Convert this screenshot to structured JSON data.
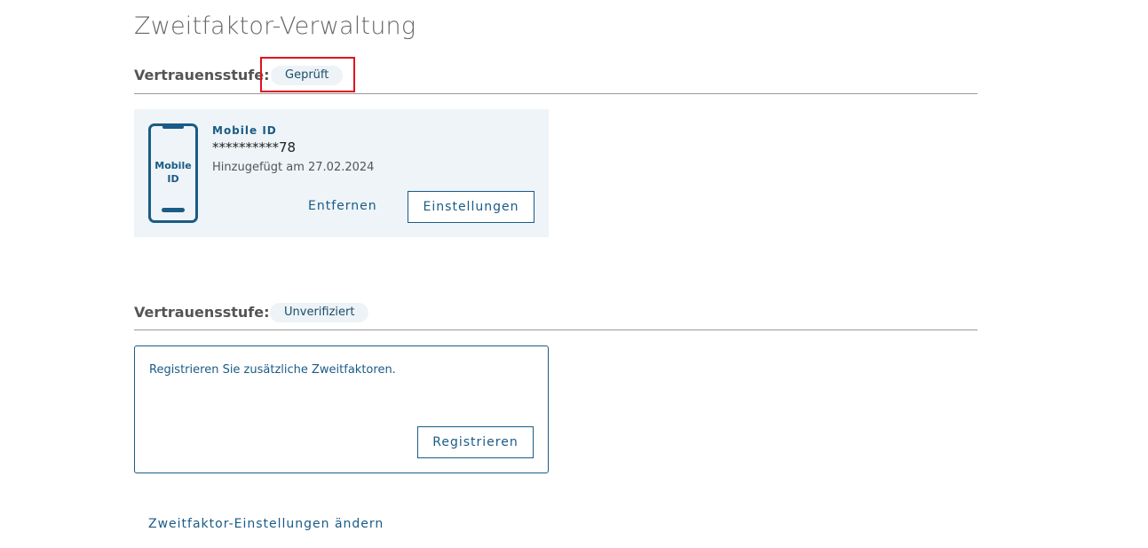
{
  "page": {
    "title": "Zweitfaktor-Verwaltung"
  },
  "verified_section": {
    "label": "Vertrauensstufe:",
    "badge": "Geprüft",
    "device": {
      "icon_label_line1": "Mobile",
      "icon_label_line2": "ID",
      "name": "Mobile ID",
      "number": "**********78",
      "added": "Hinzugefügt am 27.02.2024",
      "remove_label": "Entfernen",
      "settings_label": "Einstellungen"
    }
  },
  "unverified_section": {
    "label": "Vertrauensstufe:",
    "badge": "Unverifiziert",
    "register_text": "Registrieren Sie zusätzliche Zweitfaktoren.",
    "register_label": "Registrieren"
  },
  "footer": {
    "link_label": "Zweitfaktor-Einstellungen ändern"
  },
  "colors": {
    "accent": "#1a5b85",
    "highlight": "#e0121f",
    "badge_bg": "#edf3f7",
    "card_bg": "#eef4f7"
  },
  "icons": {
    "device_icon": "mobile-phone-icon"
  }
}
